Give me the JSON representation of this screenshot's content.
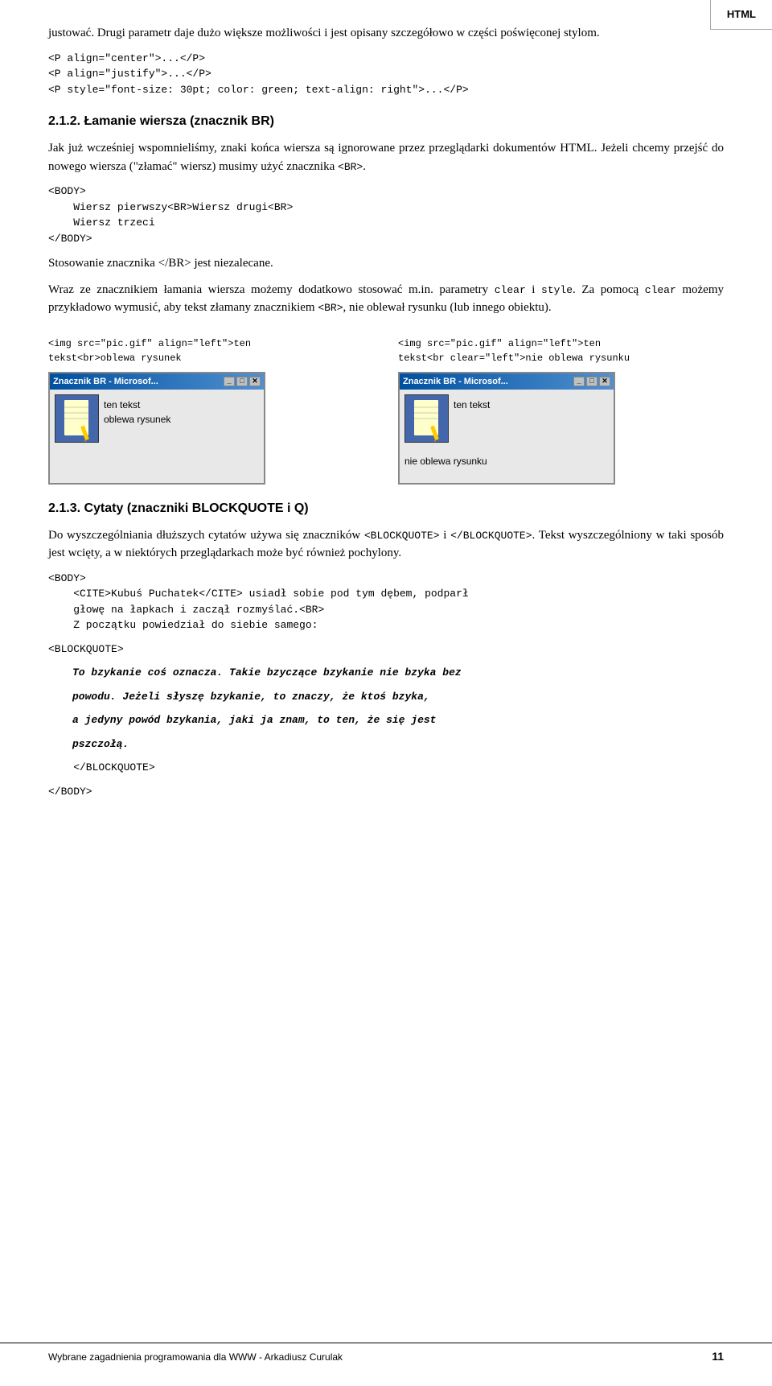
{
  "header": {
    "label": "HTML"
  },
  "content": {
    "intro_paragraph": "justować. Drugi parametr daje dużo większe możliwości i jest opisany szczegółowo w części poświęconej stylom.",
    "code_block_1": "<P align=\"center\">...</P>\n<P align=\"justify\">...</P>\n<P style=\"font-size: 30pt; color: green; text-align: right\">...</P>",
    "section_2_1_2_heading": "2.1.2. Łamanie wiersza (znacznik BR)",
    "section_2_1_2_p1": "Jak już wcześniej wspomnieliśmy, znaki końca wiersza są ignorowane przez przeglądarki dokumentów HTML. Jeżeli chcemy przejść do nowego wiersza (\"złamać\" wiersz) musimy użyć znacznika <BR>.",
    "code_block_2": "<BODY>\n    Wiersz pierwszy<BR>Wiersz drugi<BR>\n    Wiersz trzeci\n</BODY>",
    "stosowanie_text": "Stosowanie znacznika </BR> jest niezalecane.",
    "wraz_text": "Wraz ze znacznikiem łamania wiersza możemy dodatkowo stosować m.in. parametry clear i style. Za pomocą clear możemy przykładowo wymusić, aby tekst złamany znacznikiem <BR>, nie oblewał rysunku (lub innego obiektu).",
    "col1_code": "<img src=\"pic.gif\" align=\"left\">ten\ntekst<br>oblewa rysunek",
    "col2_code": "<img src=\"pic.gif\" align=\"left\">ten\ntekst<br clear=\"left\">nie oblewa rysunku",
    "screenshot1_title": "Znacznik BR - Microsof...",
    "screenshot1_text1": "ten tekst",
    "screenshot1_text2": "oblewa rysunek",
    "screenshot2_title": "Znacznik BR - Microsof...",
    "screenshot2_text1": "ten tekst",
    "screenshot2_text2": "nie oblewa rysunku",
    "section_2_1_3_heading": "2.1.3. Cytaty (znaczniki BLOCKQUOTE i Q)",
    "section_2_1_3_p1": "Do wyszczególniania dłuższych cytatów używa się znaczników <BLOCKQUOTE> i </BLOCKQUOTE>. Tekst wyszczególniony w taki sposób jest wcięty, a w niektórych przeglądarkach może być również pochylony.",
    "code_block_3_pre": "<BODY>\n    <CITE>Kubuś Puchatek</CITE> usiadł sobie pod tym dębem, podparł\n    głowę na łapkach i zaczął rozmyślać.<BR>\n    Z początku powiedział do siebie samego:",
    "code_block_3_blockquote_label": "<BLOCKQUOTE>",
    "code_block_3_blockquote_text_line1": "To bzykanie coś oznacza. Takie bzyczące bzykanie nie bzyka bez",
    "code_block_3_blockquote_text_line2": "powodu. Jeżeli słyszę bzykanie, to znaczy, że ktoś bzyka,",
    "code_block_3_blockquote_text_line3": "a jedyny powód bzykania, jaki ja znam, to ten, że się jest",
    "code_block_3_blockquote_text_line4": "pszczołą.",
    "code_block_3_end_blockquote": "    </BLOCKQUOTE>",
    "code_block_3_end_body": "</BODY>"
  },
  "footer": {
    "text": "Wybrane zagadnienia programowania dla WWW - Arkadiusz Curulak",
    "page_number": "11"
  }
}
